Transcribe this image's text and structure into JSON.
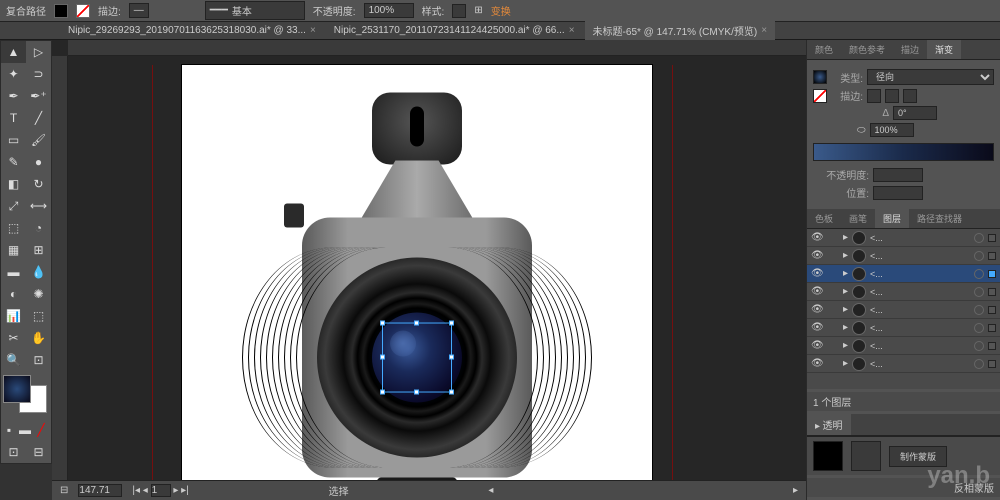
{
  "topbar": {
    "title": "复合路径",
    "stroke_label": "描边:",
    "stroke_style": "基本",
    "opacity_label": "不透明度:",
    "opacity_value": "100%",
    "style_label": "样式:",
    "transform": "变换"
  },
  "tabs": [
    {
      "label": "Nipic_29269293_20190701163625318030.ai* @ 33...",
      "active": false
    },
    {
      "label": "Nipic_2531170_20110723141124425000.ai* @ 66...",
      "active": false
    },
    {
      "label": "未标题-65* @ 147.71% (CMYK/预览)",
      "active": true
    }
  ],
  "tools": [
    "▸",
    "⬚",
    "✒",
    "✎",
    "T",
    "╱",
    "▭",
    "🖌",
    "✂",
    "↻",
    "◧",
    "▦",
    "⬚",
    "📊",
    "🔍",
    "⬚",
    "🖐",
    "🔎",
    "⬚",
    "Q"
  ],
  "gradient_panel": {
    "tabs": [
      "颜色",
      "颜色参考",
      "描边",
      "渐变"
    ],
    "active_tab": "渐变",
    "type_label": "类型:",
    "type_value": "径向",
    "stroke_label": "描边:",
    "angle_label": "Δ",
    "angle_value": "0°",
    "aspect_value": "100%",
    "opacity_label": "不透明度:",
    "position_label": "位置:"
  },
  "layers_panel": {
    "tabs": [
      "色板",
      "画笔",
      "图层",
      "路径查找器"
    ],
    "active_tab": "图层",
    "rows": [
      {
        "name": "<...",
        "sel": false
      },
      {
        "name": "<...",
        "sel": false
      },
      {
        "name": "<...",
        "sel": true
      },
      {
        "name": "<...",
        "sel": false
      },
      {
        "name": "<...",
        "sel": false
      },
      {
        "name": "<...",
        "sel": false
      },
      {
        "name": "<...",
        "sel": false
      },
      {
        "name": "<...",
        "sel": false
      }
    ],
    "footer": "1 个图层"
  },
  "transparency_panel": {
    "tab": "透明",
    "make_mask": "制作蒙版",
    "invert_mask": "反相蒙版"
  },
  "status": {
    "zoom": "147.71",
    "page": "1",
    "mode": "选择"
  },
  "watermark": "yan.b"
}
